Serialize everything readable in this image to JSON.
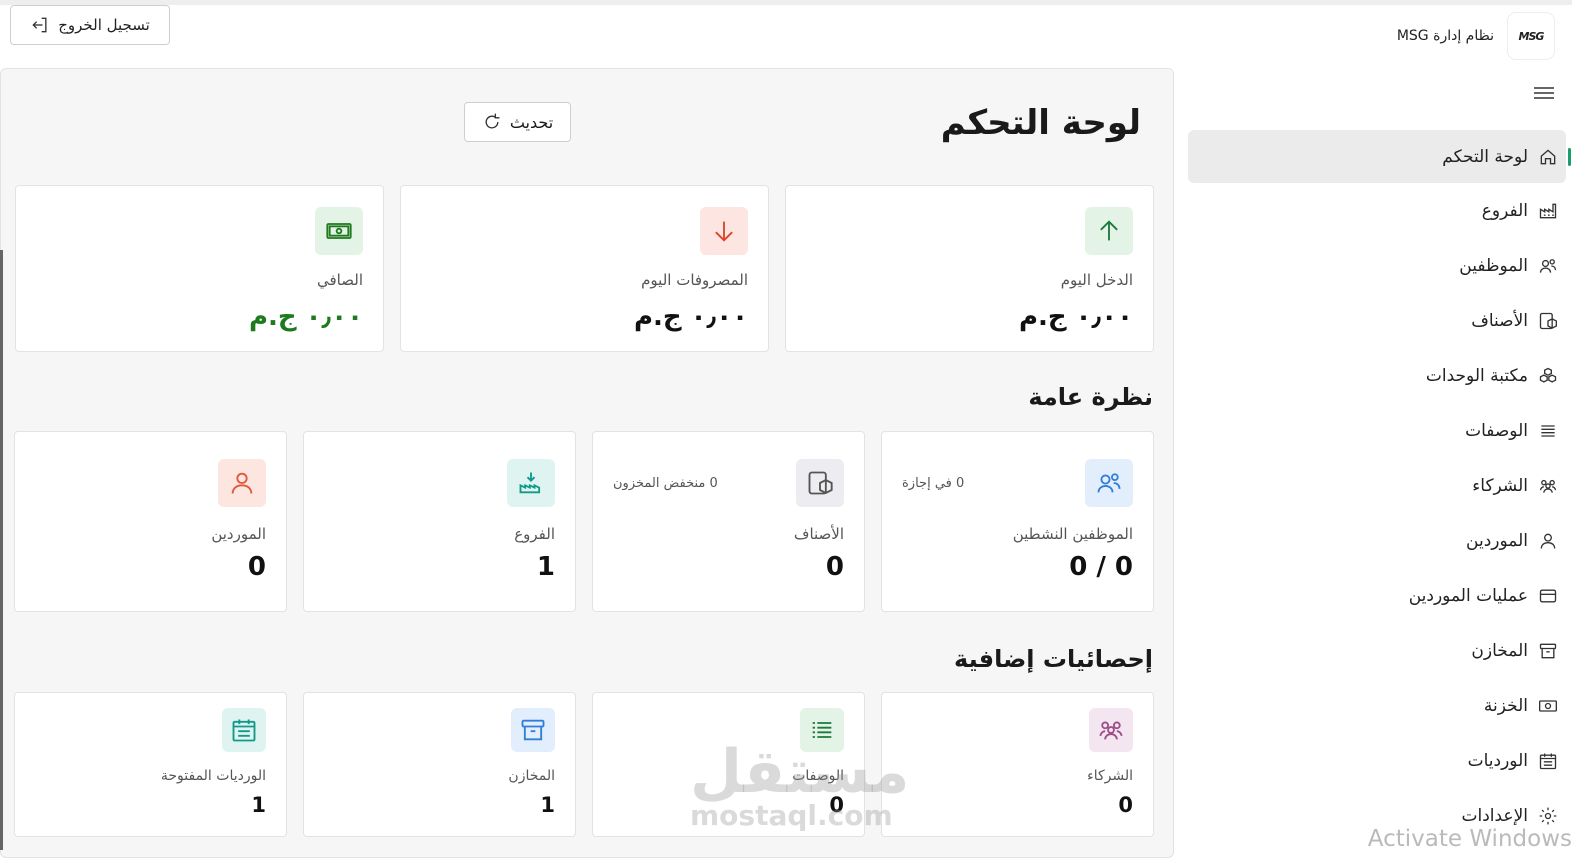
{
  "header": {
    "logout_label": "تسجيل الخروج",
    "brand_name": "نظام إدارة MSG",
    "logo_text": "MSG"
  },
  "sidebar": {
    "items": [
      {
        "label": "لوحة التحكم",
        "icon": "home-icon",
        "active": true
      },
      {
        "label": "الفروع",
        "icon": "factory-icon"
      },
      {
        "label": "الموظفين",
        "icon": "users-icon"
      },
      {
        "label": "الأصناف",
        "icon": "box-icon"
      },
      {
        "label": "مكتبة الوحدات",
        "icon": "cubes-icon"
      },
      {
        "label": "الوصفات",
        "icon": "list-icon"
      },
      {
        "label": "الشركاء",
        "icon": "partners-icon"
      },
      {
        "label": "الموردين",
        "icon": "user-icon"
      },
      {
        "label": "عمليات الموردين",
        "icon": "card-icon"
      },
      {
        "label": "المخازن",
        "icon": "archive-icon"
      },
      {
        "label": "الخزنة",
        "icon": "cash-icon"
      },
      {
        "label": "الورديات",
        "icon": "calendar-icon"
      },
      {
        "label": "الإعدادات",
        "icon": "gear-icon"
      }
    ]
  },
  "main": {
    "title": "لوحة التحكم",
    "refresh_label": "تحديث",
    "today_cards": [
      {
        "label": "الدخل اليوم",
        "value": "٠٫٠٠ ج.م",
        "icon": "arrow-up-icon",
        "color": "#1e7a3c"
      },
      {
        "label": "المصروفات اليوم",
        "value": "٠٫٠٠ ج.م",
        "icon": "arrow-down-icon",
        "color": "#d9452c"
      },
      {
        "label": "الصافي",
        "value": "٠٫٠٠ ج.م",
        "icon": "money-icon",
        "color": "#1e7a1e"
      }
    ],
    "overview_title": "نظرة عامة",
    "overview_cards": [
      {
        "label": "الموظفين النشطين",
        "value": "0 / 0",
        "side": "0 في إجازة",
        "icon": "users-icon"
      },
      {
        "label": "الأصناف",
        "value": "0",
        "side": "0 منخفض المخزون",
        "icon": "box-icon"
      },
      {
        "label": "الفروع",
        "value": "1",
        "icon": "factory-icon"
      },
      {
        "label": "الموردين",
        "value": "0",
        "icon": "user-icon"
      }
    ],
    "extra_title": "إحصائيات إضافية",
    "extra_cards": [
      {
        "label": "الشركاء",
        "value": "0",
        "icon": "partners-icon"
      },
      {
        "label": "الوصفات",
        "value": "0",
        "icon": "list-icon"
      },
      {
        "label": "المخازن",
        "value": "1",
        "icon": "archive-icon"
      },
      {
        "label": "الورديات المفتوحة",
        "value": "1",
        "icon": "calendar-icon"
      }
    ]
  },
  "watermark": {
    "arabic": "مستقل",
    "english": "mostaql.com"
  },
  "os_notice": "Activate Windows"
}
